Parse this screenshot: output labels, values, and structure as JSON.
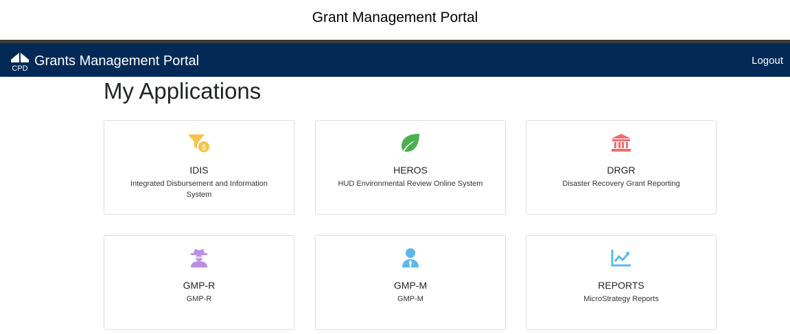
{
  "caption": "Grant Management Portal",
  "navbar": {
    "brand_logo_text": "CPD",
    "brand_title": "Grants Management Portal",
    "logout_label": "Logout",
    "background_color": "#032a57"
  },
  "page_title": "My Applications",
  "applications": [
    {
      "icon": "funnel-dollar-icon",
      "icon_color": "#f6c34a",
      "title": "IDIS",
      "description": "Integrated Disbursement and Information System"
    },
    {
      "icon": "leaf-icon",
      "icon_color": "#4caf50",
      "title": "HEROS",
      "description": "HUD Environmental Review Online System"
    },
    {
      "icon": "bank-icon",
      "icon_color": "#f26b6b",
      "title": "DRGR",
      "description": "Disaster Recovery Grant Reporting"
    },
    {
      "icon": "user-secret-icon",
      "icon_color": "#b98fe0",
      "title": "GMP-R",
      "description": "GMP-R"
    },
    {
      "icon": "user-tie-icon",
      "icon_color": "#5bb8ea",
      "title": "GMP-M",
      "description": "GMP-M"
    },
    {
      "icon": "chart-line-icon",
      "icon_color": "#5bb8ea",
      "title": "REPORTS",
      "description": "MicroStrategy Reports"
    }
  ]
}
